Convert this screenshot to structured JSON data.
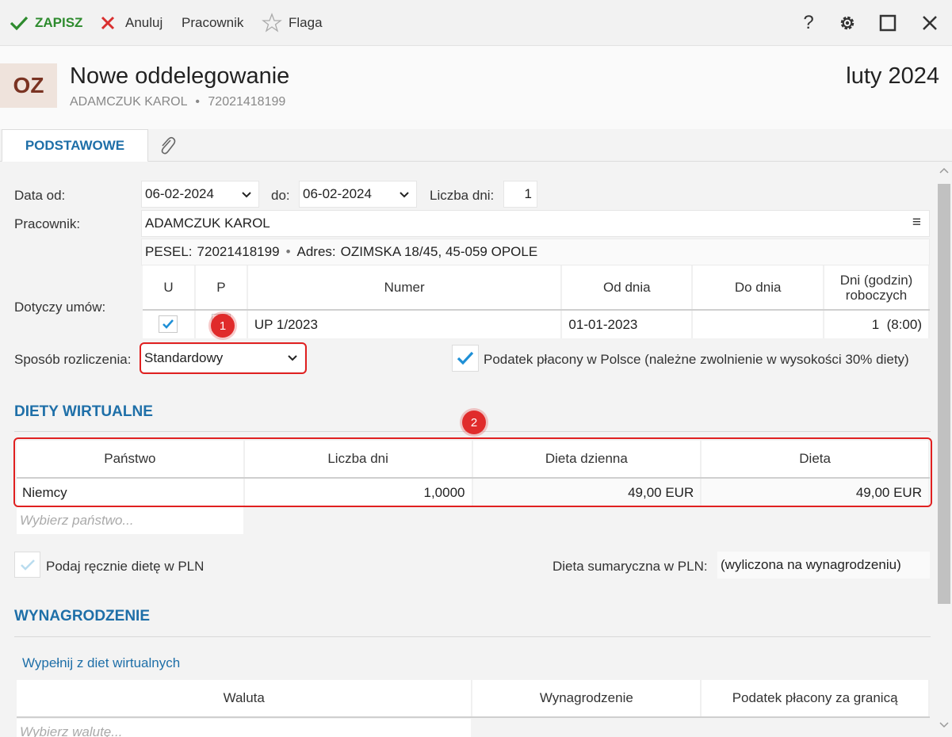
{
  "toolbar": {
    "save": "ZAPISZ",
    "cancel": "Anuluj",
    "worker": "Pracownik",
    "flag": "Flaga",
    "help": "?"
  },
  "header": {
    "avatar": "OZ",
    "title": "Nowe oddelegowanie",
    "name": "ADAMCZUK KAROL",
    "separator": "•",
    "pesel": "72021418199",
    "period": "luty 2024"
  },
  "tabs": {
    "basic": "PODSTAWOWE"
  },
  "form": {
    "date_from_label": "Data od:",
    "date_from": "06-02-2024",
    "to_label": "do:",
    "date_to": "06-02-2024",
    "days_label": "Liczba dni:",
    "days": "1",
    "worker_label": "Pracownik:",
    "worker": "ADAMCZUK KAROL",
    "pesel_label": "PESEL:",
    "pesel": "72021418199",
    "bullet": "•",
    "address_label": "Adres:",
    "address": "OZIMSKA 18/45, 45-059 OPOLE",
    "contracts_label": "Dotyczy umów:",
    "settlement_label": "Sposób rozliczenia:",
    "settlement": "Standardowy",
    "tax_poland": "Podatek płacony w Polsce (należne zwolnienie w wysokości 30% diety)",
    "tax_poland_checked": true
  },
  "contracts": {
    "headers": [
      "U",
      "P",
      "Numer",
      "Od dnia",
      "Do dnia",
      "Dni (godzin) roboczych"
    ],
    "rows": [
      {
        "u": true,
        "p": false,
        "number": "UP 1/2023",
        "from": "01-01-2023",
        "to": "",
        "days": "1  (8:00)"
      }
    ]
  },
  "virtual_diets": {
    "title": "DIETY WIRTUALNE",
    "headers": [
      "Państwo",
      "Liczba dni",
      "Dieta dzienna",
      "Dieta"
    ],
    "rows": [
      {
        "country": "Niemcy",
        "days": "1,0000",
        "daily": "49,00 EUR",
        "total": "49,00 EUR"
      }
    ],
    "placeholder": "Wybierz państwo...",
    "manual_label": "Podaj ręcznie dietę w PLN",
    "sum_label": "Dieta sumaryczna w PLN:",
    "sum_value": "(wyliczona na wynagrodzeniu)"
  },
  "salary": {
    "title": "WYNAGRODZENIE",
    "fill_link": "Wypełnij z diet wirtualnych",
    "headers": [
      "Waluta",
      "Wynagrodzenie",
      "Podatek płacony za granicą"
    ],
    "placeholder": "Wybierz walutę..."
  },
  "badges": [
    "1",
    "2"
  ],
  "colors": {
    "accent": "#1e6fa8",
    "save": "#2e8b2e",
    "cancel": "#d93030",
    "highlight": "#e02020"
  }
}
